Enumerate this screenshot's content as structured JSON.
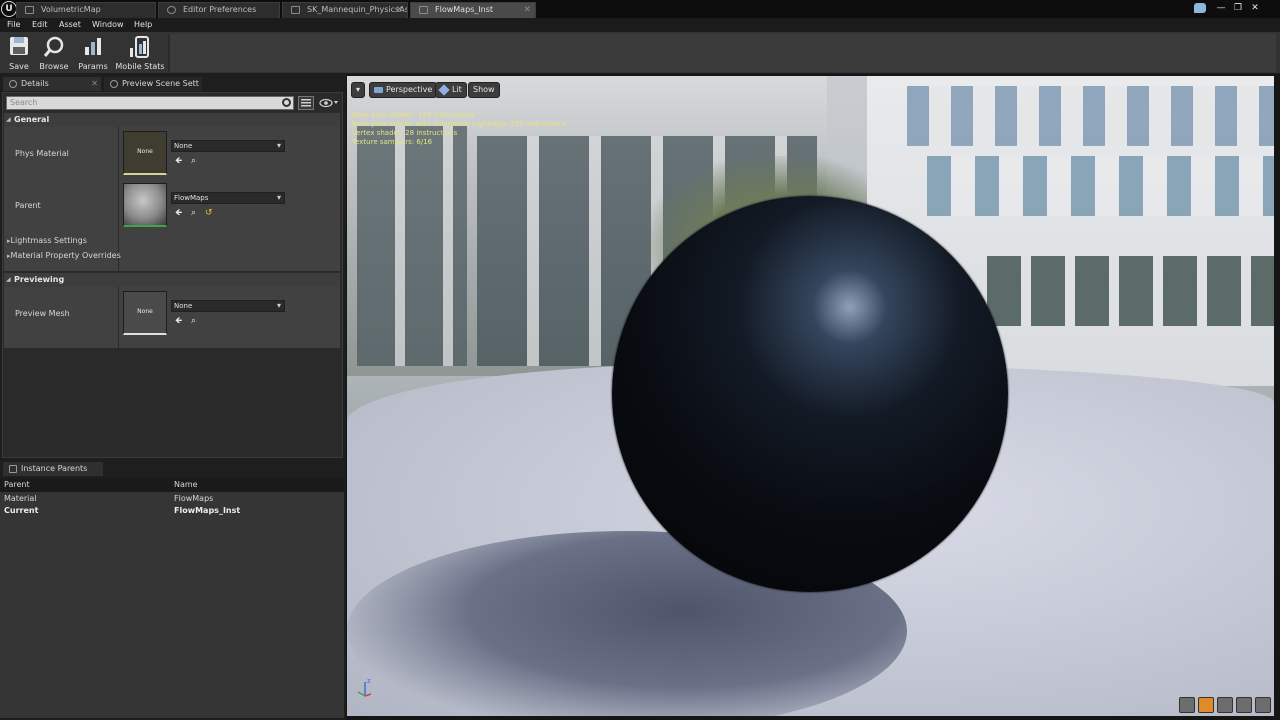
{
  "window": {
    "tabs": [
      {
        "label": "VolumetricMap",
        "active": false
      },
      {
        "label": "Editor Preferences",
        "active": false
      },
      {
        "label": "SK_Mannequin_PhysicsAs",
        "active": false
      },
      {
        "label": "FlowMaps_Inst",
        "active": true
      }
    ],
    "controls": {
      "minimize": "—",
      "maximize": "❐",
      "close": "✕"
    }
  },
  "menu": [
    "File",
    "Edit",
    "Asset",
    "Window",
    "Help"
  ],
  "toolbar": {
    "save_label": "Save",
    "browse_label": "Browse",
    "params_label": "Params",
    "mobile_stats_label": "Mobile Stats"
  },
  "panels": {
    "details_tab": "Details",
    "preview_tab": "Preview Scene Sett",
    "instance_parents_tab": "Instance Parents"
  },
  "details": {
    "search_placeholder": "Search",
    "general_header": "General",
    "phys_material_label": "Phys Material",
    "phys_material_thumb": "None",
    "phys_material_value": "None",
    "parent_label": "Parent",
    "parent_value": "FlowMaps",
    "lightmass_label": "Lightmass Settings",
    "overrides_label": "Material Property Overrides",
    "previewing_header": "Previewing",
    "preview_mesh_label": "Preview Mesh",
    "preview_mesh_thumb": "None",
    "preview_mesh_value": "None"
  },
  "instance_parents": {
    "columns": [
      "Parent",
      "Name"
    ],
    "rows": [
      {
        "parent": "Material",
        "name": "FlowMaps"
      },
      {
        "parent": "Current",
        "name": "FlowMaps_Inst"
      }
    ]
  },
  "viewport": {
    "perspective_label": "Perspective",
    "lit_label": "Lit",
    "show_label": "Show",
    "stats": [
      "Base pass shader: 155 instructions",
      "Base pass shader with Volumetric Lightmap: 228 instructions",
      "Vertex shader: 28 instructions",
      "Texture samplers: 6/16"
    ],
    "axis_label": "z"
  },
  "colors": {
    "accent_orange": "#e08a2a",
    "stats_yellow": "#e9e37d",
    "parent_thumb_border": "#3fa34d"
  }
}
